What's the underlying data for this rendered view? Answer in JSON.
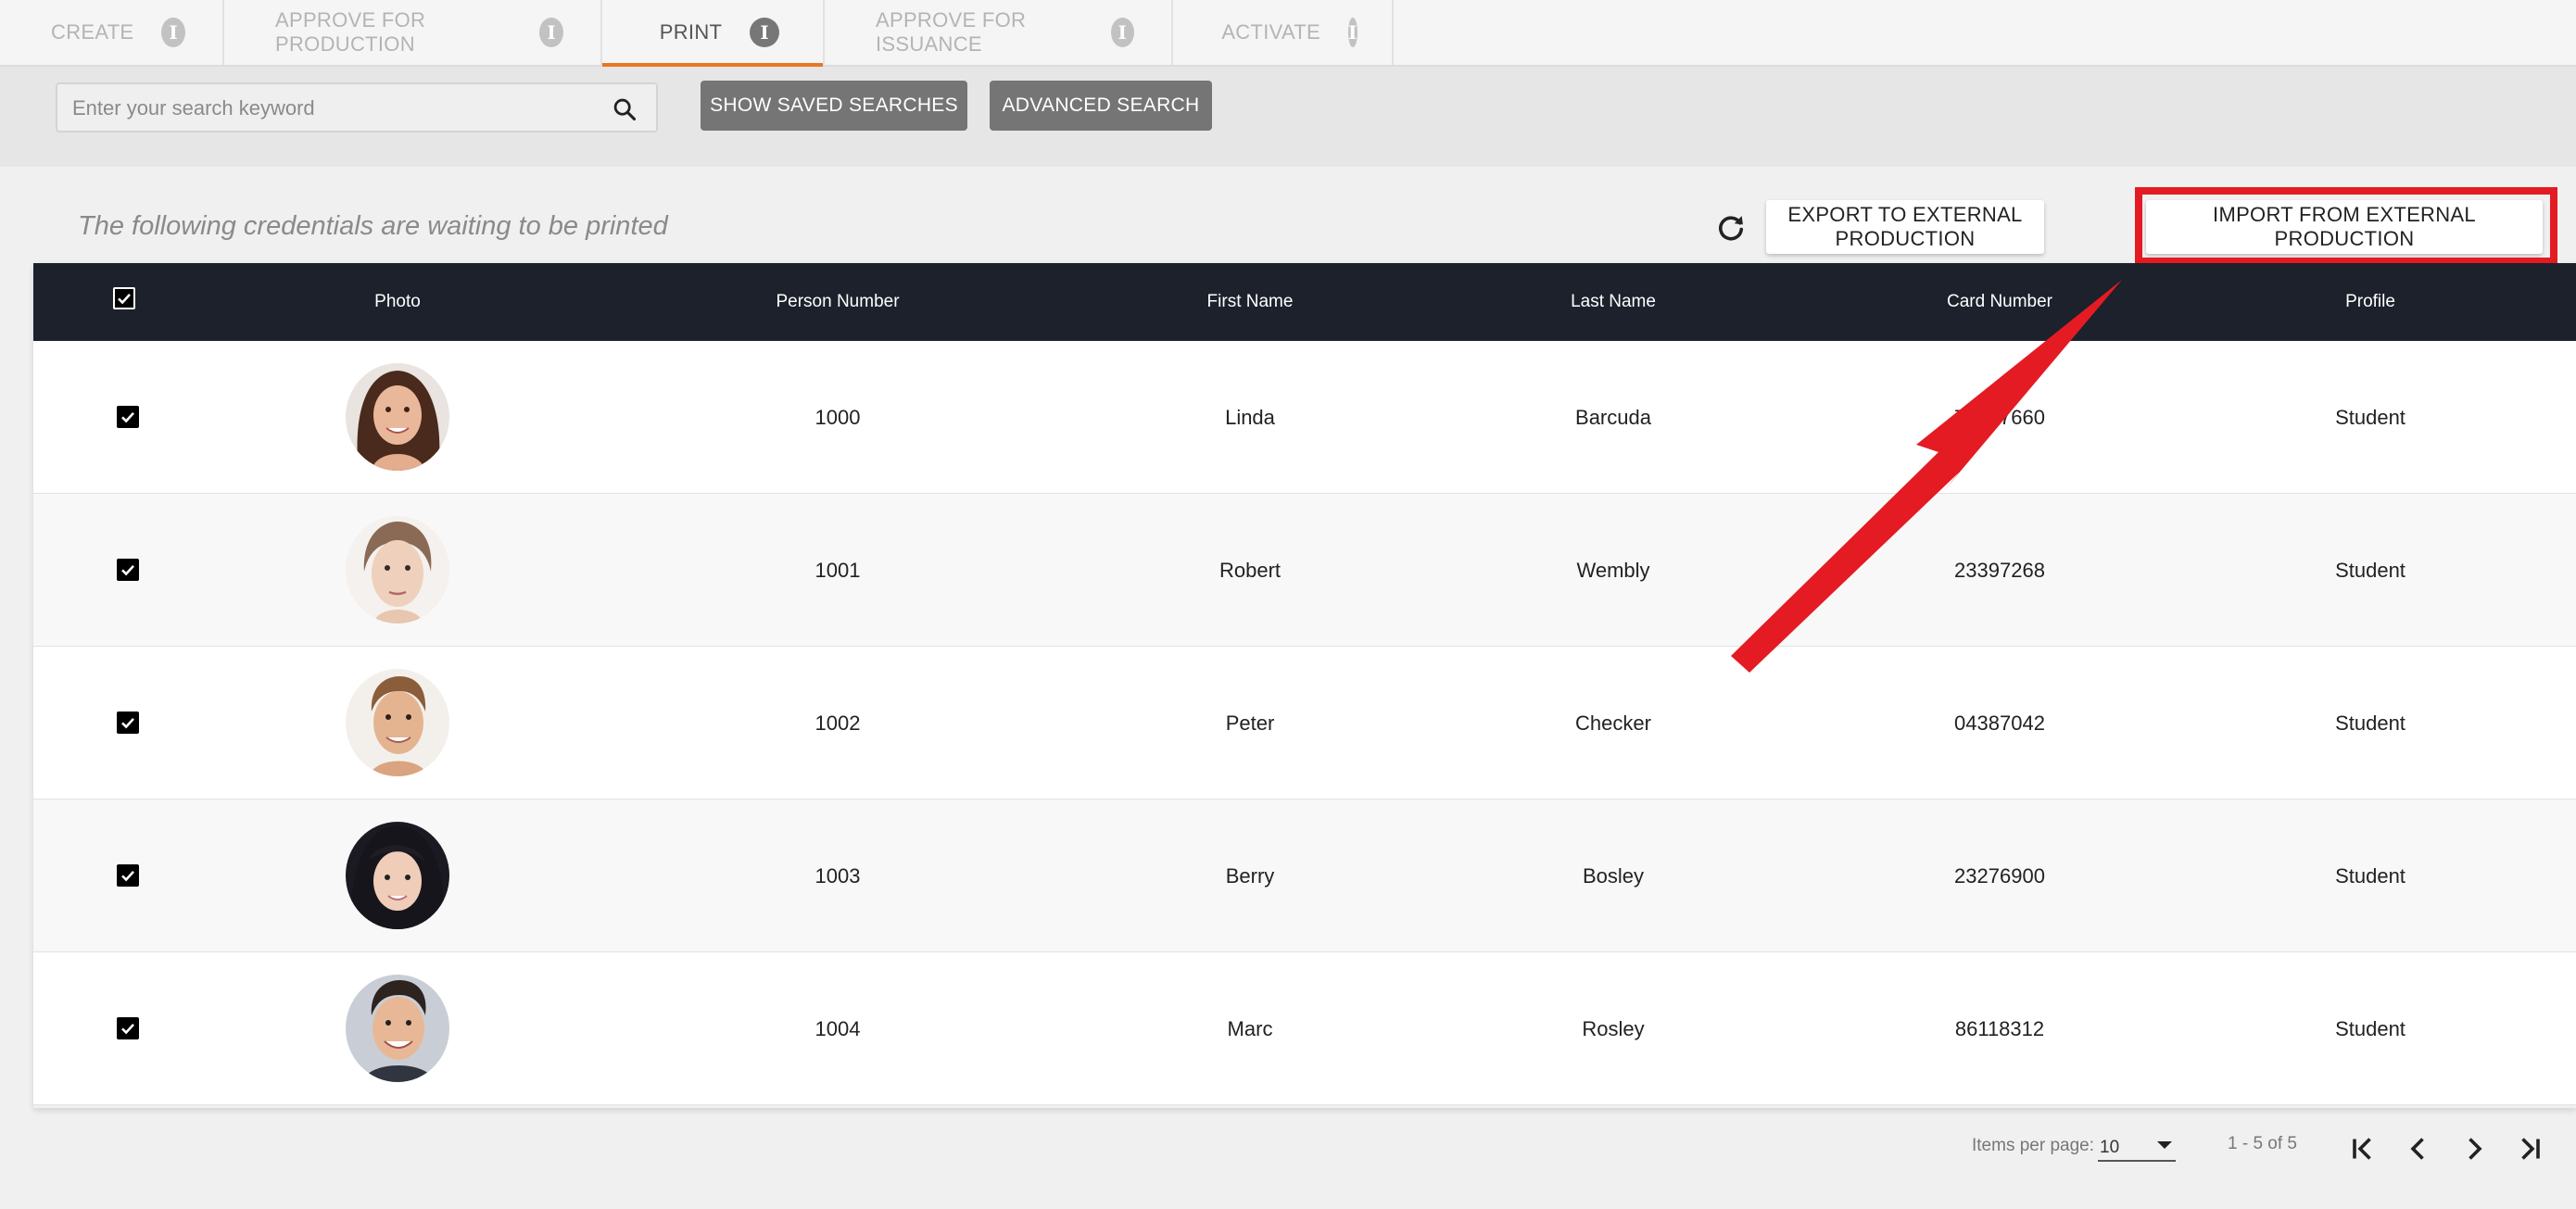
{
  "tabs": [
    {
      "label": "CREATE"
    },
    {
      "label": "APPROVE FOR PRODUCTION"
    },
    {
      "label": "PRINT"
    },
    {
      "label": "APPROVE FOR ISSUANCE"
    },
    {
      "label": "ACTIVATE"
    }
  ],
  "active_tab": "PRINT",
  "search": {
    "placeholder": "Enter your search keyword",
    "saved_label": "SHOW SAVED SEARCHES",
    "advanced_label": "ADVANCED SEARCH"
  },
  "heading": "The following credentials are waiting to be printed",
  "actions": {
    "export_label": "EXPORT TO EXTERNAL PRODUCTION",
    "import_label": "IMPORT FROM EXTERNAL PRODUCTION"
  },
  "table": {
    "headers": {
      "photo": "Photo",
      "person_number": "Person Number",
      "first_name": "First Name",
      "last_name": "Last Name",
      "card_number": "Card Number",
      "profile": "Profile"
    },
    "rows": [
      {
        "person_number": "1000",
        "first_name": "Linda",
        "last_name": "Barcuda",
        "card_number": "7???7660",
        "profile": "Student",
        "checked": true
      },
      {
        "person_number": "1001",
        "first_name": "Robert",
        "last_name": "Wembly",
        "card_number": "23397268",
        "profile": "Student",
        "checked": true
      },
      {
        "person_number": "1002",
        "first_name": "Peter",
        "last_name": "Checker",
        "card_number": "04387042",
        "profile": "Student",
        "checked": true
      },
      {
        "person_number": "1003",
        "first_name": "Berry",
        "last_name": "Bosley",
        "card_number": "23276900",
        "profile": "Student",
        "checked": true
      },
      {
        "person_number": "1004",
        "first_name": "Marc",
        "last_name": "Rosley",
        "card_number": "86118312",
        "profile": "Student",
        "checked": true
      }
    ]
  },
  "pagination": {
    "items_per_page_label": "Items per page:",
    "items_per_page": "10",
    "range": "1 - 5 of 5"
  },
  "colors": {
    "accent": "#e87722",
    "header_bg": "#1c212c",
    "annotation": "#e41b23"
  }
}
